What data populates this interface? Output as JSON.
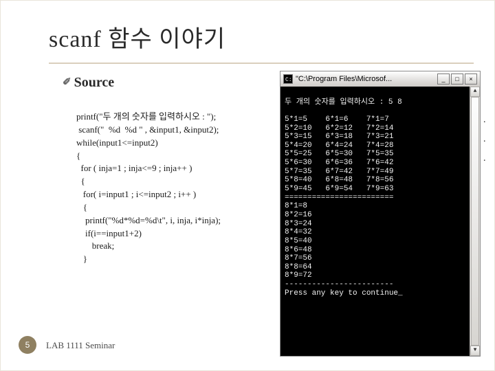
{
  "title": "scanf 함수 이야기",
  "section": "Source",
  "code": "printf(\"두 개의 숫자를 입력하시오 : \");\n scanf(\"  %d  %d \" , &input1, &input2);\nwhile(input1<=input2)\n{\n  for ( inja=1 ; inja<=9 ; inja++ )\n  {\n   for( i=input1 ; i<=input2 ; i++ )\n   {\n    printf(\"%d*%d=%d\\t\", i, inja, i*inja);\n    if(i==input1+2)\n       break;\n   }",
  "console": {
    "window_title": "\"C:\\Program Files\\Microsof...",
    "buttons": {
      "min": "_",
      "max": "□",
      "close": "×"
    },
    "scroll": {
      "up": "▲",
      "down": "▼"
    },
    "lines": [
      "두 개의 숫자를 입력하시오 : 5 8",
      "",
      "5*1=5    6*1=6    7*1=7",
      "5*2=10   6*2=12   7*2=14",
      "5*3=15   6*3=18   7*3=21",
      "5*4=20   6*4=24   7*4=28",
      "5*5=25   6*5=30   7*5=35",
      "5*6=30   6*6=36   7*6=42",
      "5*7=35   6*7=42   7*7=49",
      "5*8=40   6*8=48   7*8=56",
      "5*9=45   6*9=54   7*9=63",
      "========================",
      "8*1=8",
      "8*2=16",
      "8*3=24",
      "8*4=32",
      "8*5=40",
      "8*6=48",
      "8*7=56",
      "8*8=64",
      "8*9=72",
      "------------------------",
      "Press any key to continue_"
    ]
  },
  "page_number": "5",
  "footer": "LAB 1111 Seminar",
  "side_marks": ".\n\n.\n."
}
